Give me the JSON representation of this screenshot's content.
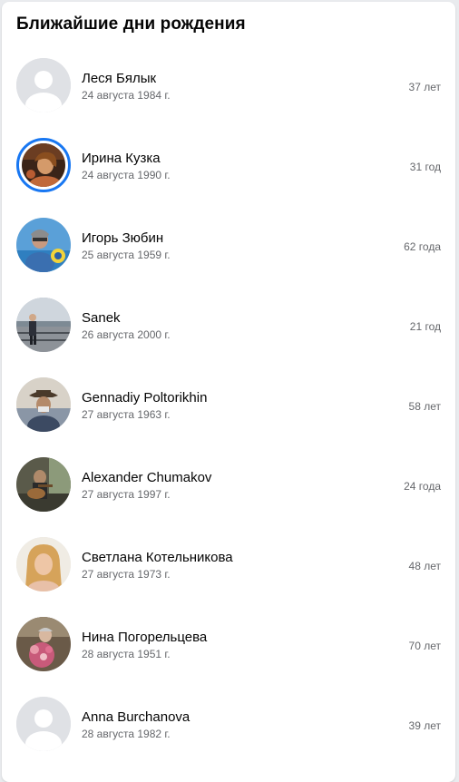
{
  "title": "Ближайшие дни рождения",
  "people": [
    {
      "name": "Леся Бялык",
      "date": "24 августа 1984 г.",
      "age": "37 лет",
      "avatar": "default-avatar-icon"
    },
    {
      "name": "Ирина Кузка",
      "date": "24 августа 1990 г.",
      "age": "31 год",
      "avatar": "photo-story-ring"
    },
    {
      "name": "Игорь Зюбин",
      "date": "25 августа 1959 г.",
      "age": "62 года",
      "avatar": "photo"
    },
    {
      "name": "Sanek",
      "date": "26 августа 2000 г.",
      "age": "21 год",
      "avatar": "photo"
    },
    {
      "name": "Gennadiy Poltorikhin",
      "date": "27 августа 1963 г.",
      "age": "58 лет",
      "avatar": "photo"
    },
    {
      "name": "Alexander Chumakov",
      "date": "27 августа 1997 г.",
      "age": "24 года",
      "avatar": "photo"
    },
    {
      "name": "Светлана Котельникова",
      "date": "27 августа 1973 г.",
      "age": "48 лет",
      "avatar": "photo"
    },
    {
      "name": "Нина Погорельцева",
      "date": "28 августа 1951 г.",
      "age": "70 лет",
      "avatar": "photo"
    },
    {
      "name": "Anna Burchanova",
      "date": "28 августа 1982 г.",
      "age": "39 лет",
      "avatar": "default-avatar-icon"
    }
  ],
  "colors": {
    "accent": "#1877f2",
    "primary_text": "#050505",
    "secondary_text": "#65676b",
    "background": "#e9ebee",
    "card": "#ffffff"
  }
}
